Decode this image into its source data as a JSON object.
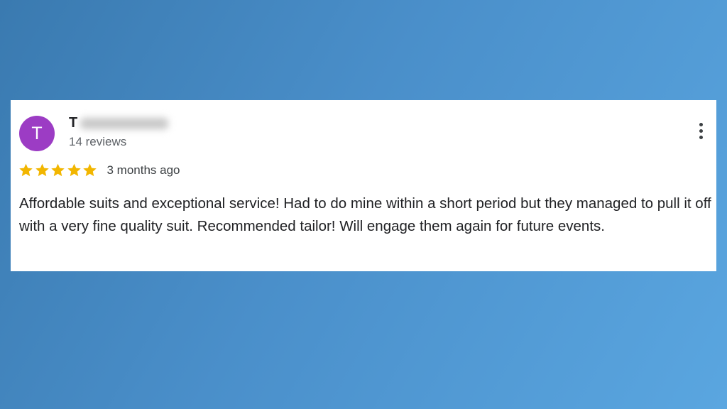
{
  "review": {
    "avatar_letter": "T",
    "avatar_color": "#9c3cc4",
    "reviewer_name_visible": "T",
    "review_count": "14 reviews",
    "rating": 5,
    "rating_max": 5,
    "star_color": "#f2b600",
    "date": "3 months ago",
    "text": "Affordable suits and exceptional service! Had to do mine within a short period but they managed to pull it off with a very fine quality suit. Recommended tailor! Will engage them again for future events.",
    "menu_icon": "more-vert-icon"
  }
}
